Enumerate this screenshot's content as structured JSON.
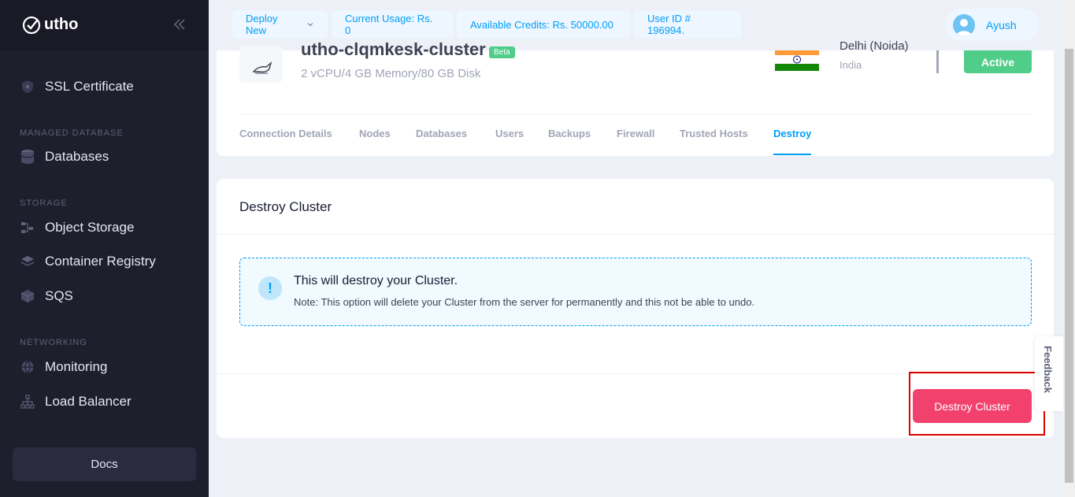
{
  "sidebar": {
    "logo_text": "utho",
    "items": {
      "ssl": "SSL Certificate",
      "databases": "Databases",
      "object_storage": "Object Storage",
      "container_registry": "Container Registry",
      "sqs": "SQS",
      "monitoring": "Monitoring",
      "load_balancer": "Load Balancer"
    },
    "sections": {
      "managed_database": "MANAGED DATABASE",
      "storage": "STORAGE",
      "networking": "NETWORKING"
    },
    "docs_label": "Docs"
  },
  "header": {
    "deploy_new": "Deploy New",
    "current_usage": "Current Usage: Rs. 0",
    "available_credits": "Available Credits: Rs. 50000.00",
    "user_id": "User ID # 196994.",
    "user_name": "Ayush"
  },
  "cluster": {
    "name": "utho-clqmkesk-cluster",
    "badge": "Beta",
    "specs": "2 vCPU/4 GB Memory/80 GB Disk",
    "location_city": "Delhi (Noida)",
    "location_country": "India",
    "status": "Active"
  },
  "tabs": [
    "Connection Details",
    "Nodes",
    "Databases",
    "Users",
    "Backups",
    "Firewall",
    "Trusted Hosts",
    "Destroy"
  ],
  "destroy": {
    "title": "Destroy Cluster",
    "notice_title": "This will destroy your Cluster.",
    "notice_text": "Note: This option will delete your Cluster from the server for permanently and this not be able to undo.",
    "button": "Destroy Cluster"
  },
  "feedback_label": "Feedback",
  "colors": {
    "accent": "#009ef7",
    "danger": "#f1416c",
    "success": "#50cd89",
    "sidebar_bg": "#1e1e2d"
  }
}
